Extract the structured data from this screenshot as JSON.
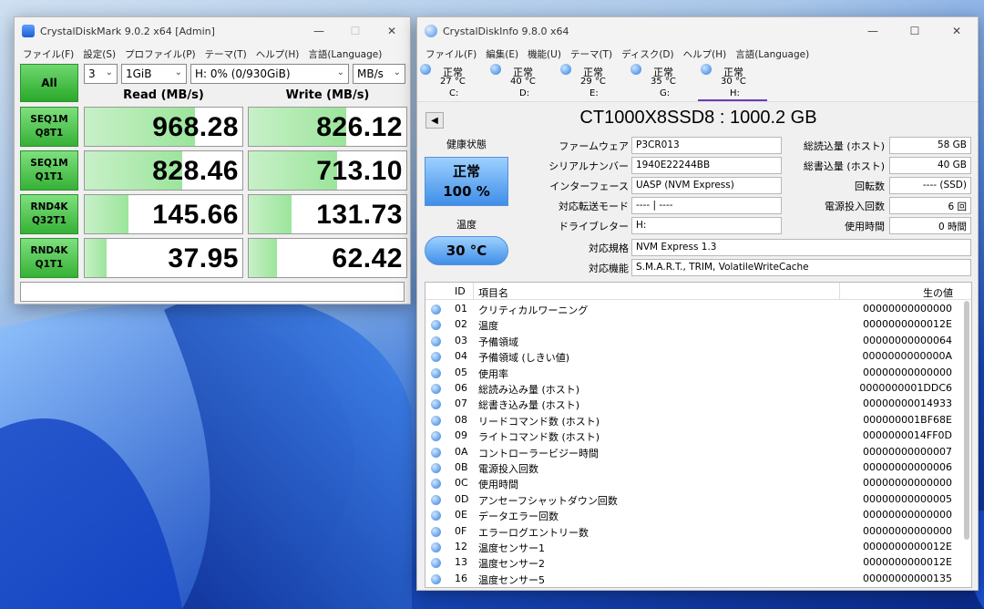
{
  "cdm": {
    "title": "CrystalDiskMark 9.0.2 x64 [Admin]",
    "window_controls": {
      "minimize": "—",
      "maximize": "☐",
      "close": "✕"
    },
    "menu": [
      "ファイル(F)",
      "設定(S)",
      "プロファイル(P)",
      "テーマ(T)",
      "ヘルプ(H)",
      "言語(Language)"
    ],
    "all_button": "All",
    "count": "3",
    "size": "1GiB",
    "drive": "H: 0% (0/930GiB)",
    "unit": "MB/s",
    "read_header": "Read (MB/s)",
    "write_header": "Write (MB/s)",
    "rows": [
      {
        "label1": "SEQ1M",
        "label2": "Q8T1",
        "read": "968.28",
        "write": "826.12",
        "read_fill": 0.7,
        "write_fill": 0.62
      },
      {
        "label1": "SEQ1M",
        "label2": "Q1T1",
        "read": "828.46",
        "write": "713.10",
        "read_fill": 0.62,
        "write_fill": 0.56
      },
      {
        "label1": "RND4K",
        "label2": "Q32T1",
        "read": "145.66",
        "write": "131.73",
        "read_fill": 0.28,
        "write_fill": 0.27
      },
      {
        "label1": "RND4K",
        "label2": "Q1T1",
        "read": "37.95",
        "write": "62.42",
        "read_fill": 0.14,
        "write_fill": 0.18
      }
    ],
    "comment": ""
  },
  "cdi": {
    "title": "CrystalDiskInfo 9.8.0 x64",
    "window_controls": {
      "minimize": "—",
      "maximize": "☐",
      "close": "✕"
    },
    "menu": [
      "ファイル(F)",
      "編集(E)",
      "機能(U)",
      "テーマ(T)",
      "ディスク(D)",
      "ヘルプ(H)",
      "言語(Language)"
    ],
    "drive_tabs": [
      {
        "status": "正常",
        "temp": "27 °C",
        "letter": "C:"
      },
      {
        "status": "正常",
        "temp": "40 °C",
        "letter": "D:"
      },
      {
        "status": "正常",
        "temp": "29 °C",
        "letter": "E:"
      },
      {
        "status": "正常",
        "temp": "35 °C",
        "letter": "G:"
      },
      {
        "status": "正常",
        "temp": "30 °C",
        "letter": "H:"
      }
    ],
    "prev_button": "◀",
    "disk_title": "CT1000X8SSD8 : 1000.2 GB",
    "health_label": "健康状態",
    "health_status": "正常",
    "health_percent": "100 %",
    "temp_label": "温度",
    "temp_value": "30 °C",
    "fields": {
      "firmware_label": "ファームウェア",
      "firmware": "P3CR013",
      "serial_label": "シリアルナンバー",
      "serial": "1940E22244BB",
      "interface_label": "インターフェース",
      "interface": "UASP (NVM Express)",
      "transfer_label": "対応転送モード",
      "transfer": "---- | ----",
      "letter_label": "ドライブレター",
      "letter": "H:",
      "standard_label": "対応規格",
      "standard": "NVM Express 1.3",
      "features_label": "対応機能",
      "features": "S.M.A.R.T., TRIM, VolatileWriteCache",
      "host_reads_label": "総読込量 (ホスト)",
      "host_reads": "58 GB",
      "host_writes_label": "総書込量 (ホスト)",
      "host_writes": "40 GB",
      "rotation_label": "回転数",
      "rotation": "---- (SSD)",
      "power_count_label": "電源投入回数",
      "power_count": "6 回",
      "power_hours_label": "使用時間",
      "power_hours": "0 時間"
    },
    "smart_headers": {
      "id": "ID",
      "name": "項目名",
      "raw": "生の値"
    },
    "smart": [
      {
        "id": "01",
        "name": "クリティカルワーニング",
        "raw": "00000000000000"
      },
      {
        "id": "02",
        "name": "温度",
        "raw": "0000000000012E"
      },
      {
        "id": "03",
        "name": "予備領域",
        "raw": "00000000000064"
      },
      {
        "id": "04",
        "name": "予備領域 (しきい値)",
        "raw": "0000000000000A"
      },
      {
        "id": "05",
        "name": "使用率",
        "raw": "00000000000000"
      },
      {
        "id": "06",
        "name": "総読み込み量 (ホスト)",
        "raw": "0000000001DDC6"
      },
      {
        "id": "07",
        "name": "総書き込み量 (ホスト)",
        "raw": "00000000014933"
      },
      {
        "id": "08",
        "name": "リードコマンド数 (ホスト)",
        "raw": "000000001BF68E"
      },
      {
        "id": "09",
        "name": "ライトコマンド数 (ホスト)",
        "raw": "0000000014FF0D"
      },
      {
        "id": "0A",
        "name": "コントローラービジー時間",
        "raw": "00000000000007"
      },
      {
        "id": "0B",
        "name": "電源投入回数",
        "raw": "00000000000006"
      },
      {
        "id": "0C",
        "name": "使用時間",
        "raw": "00000000000000"
      },
      {
        "id": "0D",
        "name": "アンセーフシャットダウン回数",
        "raw": "00000000000005"
      },
      {
        "id": "0E",
        "name": "データエラー回数",
        "raw": "00000000000000"
      },
      {
        "id": "0F",
        "name": "エラーログエントリー数",
        "raw": "00000000000000"
      },
      {
        "id": "12",
        "name": "温度センサー1",
        "raw": "0000000000012E"
      },
      {
        "id": "13",
        "name": "温度センサー2",
        "raw": "0000000000012E"
      },
      {
        "id": "16",
        "name": "温度センサー5",
        "raw": "00000000000135"
      }
    ]
  }
}
